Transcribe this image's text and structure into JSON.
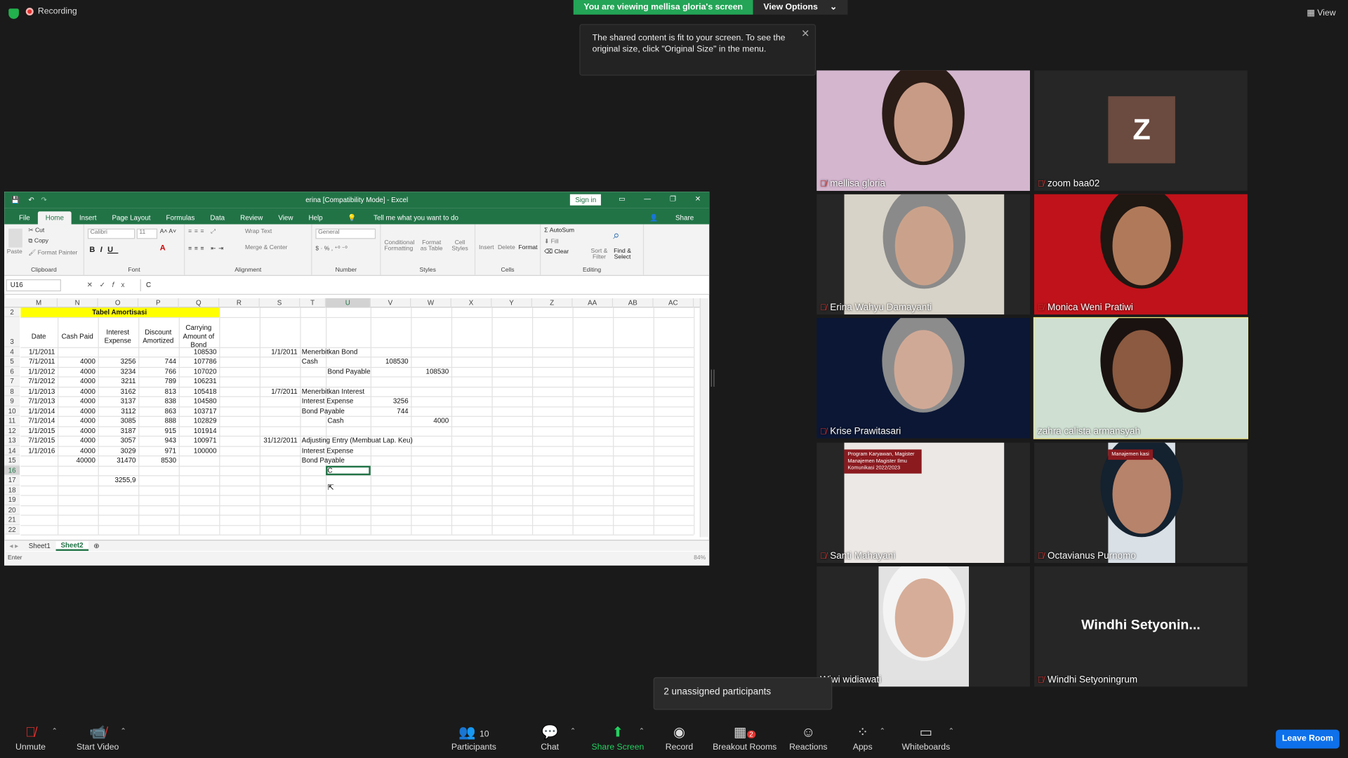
{
  "meeting": {
    "recording_label": "Recording",
    "share_banner": "You are viewing mellisa gloria's screen",
    "view_options": "View Options",
    "view_label": "View",
    "tooltip": "The shared content is fit to your screen. To see the original size, click \"Original Size\" in the menu.",
    "unassigned": "2 unassigned participants"
  },
  "excel": {
    "title": "erina  [Compatibility Mode]  -  Excel",
    "sign_in": "Sign in",
    "tabs": [
      "File",
      "Home",
      "Insert",
      "Page Layout",
      "Formulas",
      "Data",
      "Review",
      "View",
      "Help"
    ],
    "tell_me": "Tell me what you want to do",
    "share": "Share",
    "ribbon": {
      "clipboard": {
        "paste": "Paste",
        "cut": "Cut",
        "copy": "Copy",
        "format_painter": "Format Painter",
        "label": "Clipboard"
      },
      "font": {
        "name": "Calibri",
        "size": "11",
        "label": "Font"
      },
      "alignment": {
        "wrap": "Wrap Text",
        "merge": "Merge & Center",
        "label": "Alignment"
      },
      "number": {
        "format": "General",
        "label": "Number"
      },
      "styles": {
        "cond": "Conditional Formatting",
        "table": "Format as Table",
        "cell": "Cell Styles",
        "label": "Styles"
      },
      "cells": {
        "insert": "Insert",
        "delete": "Delete",
        "format": "Format",
        "label": "Cells"
      },
      "editing": {
        "autosum": "AutoSum",
        "fill": "Fill",
        "clear": "Clear",
        "sort": "Sort & Filter",
        "find": "Find & Select",
        "label": "Editing"
      }
    },
    "name_box": "U16",
    "formula": "C",
    "columns": [
      "M",
      "N",
      "O",
      "P",
      "Q",
      "R",
      "S",
      "T",
      "U",
      "V",
      "W",
      "X",
      "Y",
      "Z",
      "AA",
      "AB",
      "AC"
    ],
    "rows": [
      "2",
      "3",
      "4",
      "5",
      "6",
      "7",
      "8",
      "9",
      "10",
      "11",
      "12",
      "13",
      "14",
      "15",
      "16",
      "17",
      "18",
      "19",
      "20",
      "21",
      "22"
    ],
    "table_title": "Tabel Amortisasi",
    "headers": [
      "Date",
      "Cash Paid",
      "Interest Expense",
      "Discount Amortized",
      "Carrying Amount of Bond"
    ],
    "data": [
      [
        "1/1/2011",
        "",
        "",
        "",
        "108530"
      ],
      [
        "7/1/2011",
        "4000",
        "3256",
        "744",
        "107786"
      ],
      [
        "1/1/2012",
        "4000",
        "3234",
        "766",
        "107020"
      ],
      [
        "7/1/2012",
        "4000",
        "3211",
        "789",
        "106231"
      ],
      [
        "1/1/2013",
        "4000",
        "3162",
        "813",
        "105418"
      ],
      [
        "7/1/2013",
        "4000",
        "3137",
        "838",
        "104580"
      ],
      [
        "1/1/2014",
        "4000",
        "3112",
        "863",
        "103717"
      ],
      [
        "7/1/2014",
        "4000",
        "3085",
        "888",
        "102829"
      ],
      [
        "1/1/2015",
        "4000",
        "3187",
        "915",
        "101914"
      ],
      [
        "7/1/2015",
        "4000",
        "3057",
        "943",
        "100971"
      ],
      [
        "1/1/2016",
        "4000",
        "3029",
        "971",
        "100000"
      ],
      [
        "",
        "40000",
        "31470",
        "8530",
        ""
      ]
    ],
    "extra_cell": "3255,9",
    "journal": [
      {
        "date": "1/1/2011",
        "text": "Menerbitkan Bond"
      },
      {
        "text": "Cash",
        "v": "108530"
      },
      {
        "text": "Bond Payable",
        "w": "108530",
        "indent": true
      },
      {
        "text": ""
      },
      {
        "date": "1/7/2011",
        "text": "Menerbitkan Interest"
      },
      {
        "text": "Interest Expense",
        "v": "3256"
      },
      {
        "text": "Bond Payable",
        "v": "744"
      },
      {
        "text": "Cash",
        "w": "4000",
        "indent": true
      },
      {
        "text": ""
      },
      {
        "date": "31/12/2011",
        "text": "Adjusting Entry (Membuat Lap. Keu)"
      },
      {
        "text": "Interest Expense"
      },
      {
        "text": "Bond Payable"
      },
      {
        "text": "C",
        "indent": true,
        "active": true
      }
    ],
    "sheets": [
      "Sheet1",
      "Sheet2"
    ],
    "status": "Enter",
    "zoom": "84%"
  },
  "participants": [
    {
      "name": "mellisa gloria"
    },
    {
      "name": "zoom baa02",
      "initial": "Z"
    },
    {
      "name": "Erina Wahyu Damayanti"
    },
    {
      "name": "Monica Weni Pratiwi"
    },
    {
      "name": "Krise Prawitasari"
    },
    {
      "name": "zahra calista armansyah"
    },
    {
      "name": "Santi Mahayani",
      "sign": "Program Karyawan, Magister Manajemen Magister Ilmu Komunikasi 2022/2023"
    },
    {
      "name": "Octavianus Purnomo",
      "sign": "Manajemen kasi"
    },
    {
      "name": "Wiwi widiawati"
    },
    {
      "name": "Windhi Setyoningrum",
      "big": "Windhi  Setyonin..."
    }
  ],
  "toolbar": {
    "unmute": "Unmute",
    "start_video": "Start Video",
    "participants": "Participants",
    "participants_count": "10",
    "chat": "Chat",
    "share": "Share Screen",
    "record": "Record",
    "breakout": "Breakout Rooms",
    "breakout_count": "2",
    "reactions": "Reactions",
    "apps": "Apps",
    "whiteboards": "Whiteboards",
    "leave": "Leave Room"
  }
}
